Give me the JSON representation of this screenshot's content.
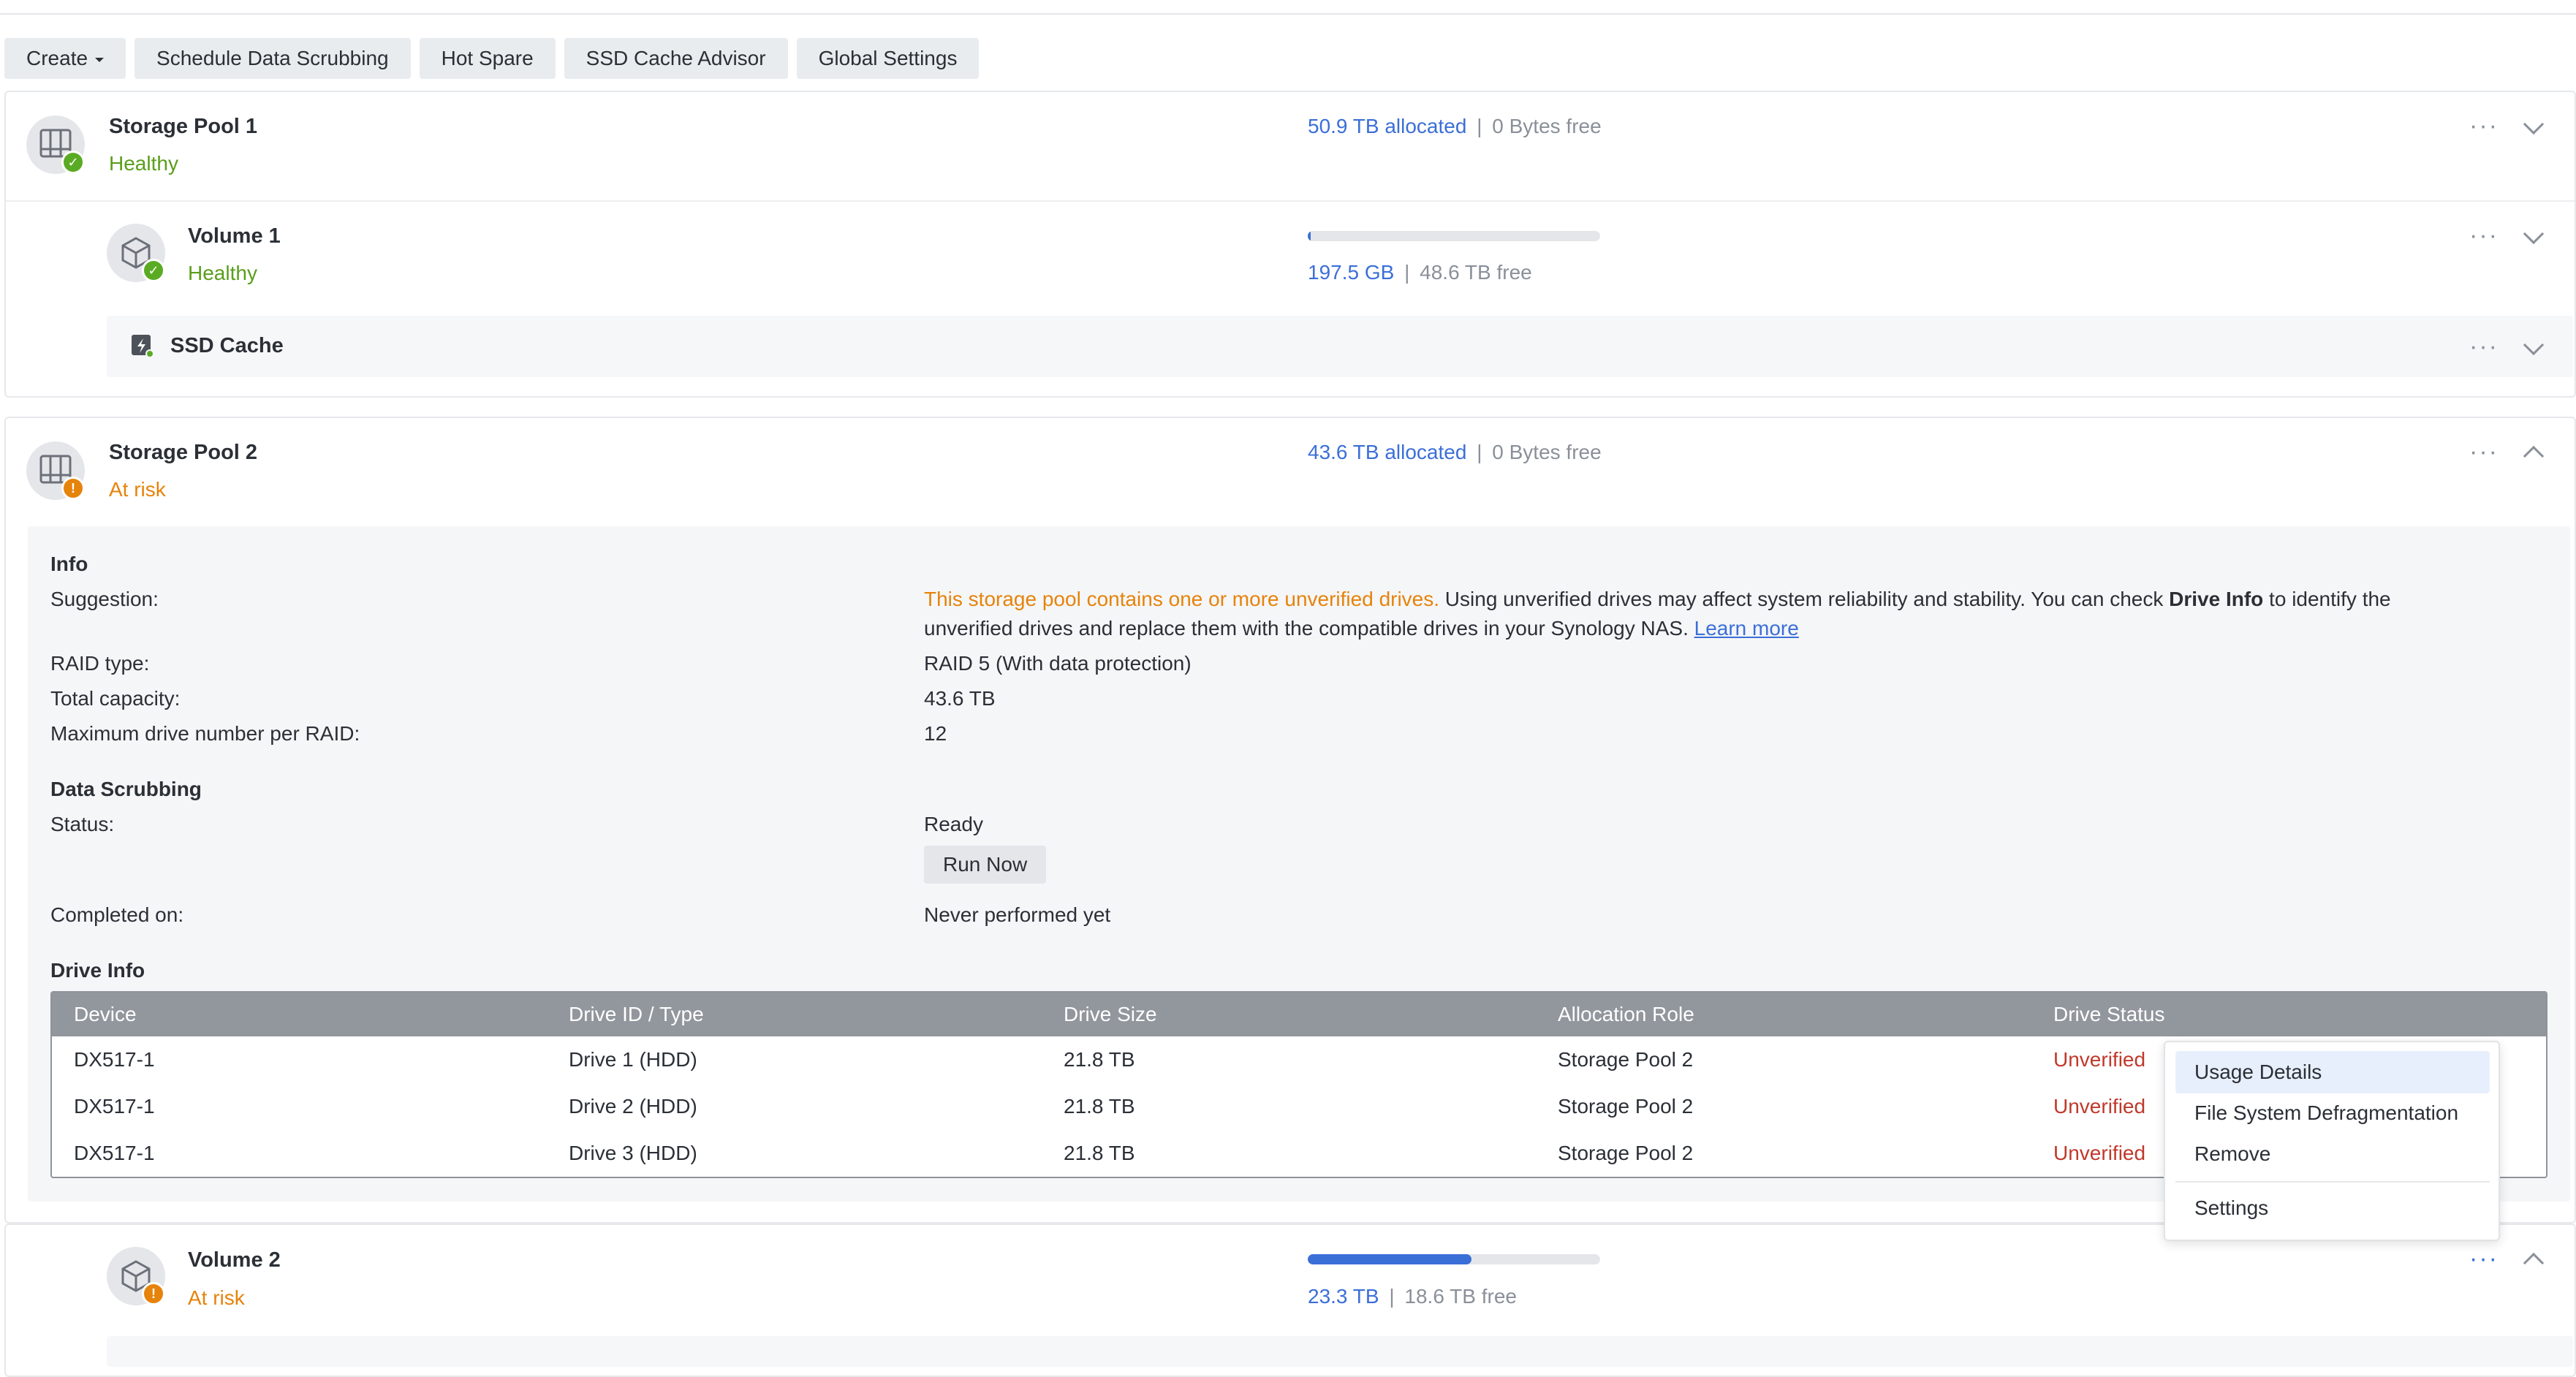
{
  "toolbar": {
    "create": "Create",
    "schedule": "Schedule Data Scrubbing",
    "hot_spare": "Hot Spare",
    "ssd_advisor": "SSD Cache Advisor",
    "global_settings": "Global Settings"
  },
  "pool1": {
    "title": "Storage Pool 1",
    "status": "Healthy",
    "allocated": "50.9 TB allocated",
    "separator": "|",
    "free": "0 Bytes free",
    "volume": {
      "title": "Volume 1",
      "status": "Healthy",
      "used": "197.5 GB",
      "separator": "|",
      "free": "48.6 TB free",
      "usage_fraction": 0.004
    },
    "ssd_cache": {
      "title": "SSD Cache"
    }
  },
  "pool2": {
    "title": "Storage Pool 2",
    "status": "At risk",
    "allocated": "43.6 TB allocated",
    "separator": "|",
    "free": "0 Bytes free",
    "info": {
      "heading": "Info",
      "suggestion_label": "Suggestion:",
      "suggestion_warn": "This storage pool contains one or more unverified drives.",
      "suggestion_text_a": " Using unverified drives may affect system reliability and stability. You can check ",
      "suggestion_bold": "Drive Info",
      "suggestion_text_b": " to identify the",
      "suggestion_line2": "unverified drives and replace them with the compatible drives in your Synology NAS. ",
      "learn_more": "Learn more",
      "raid_label": "RAID type:",
      "raid_value": "RAID 5 (With data protection)",
      "capacity_label": "Total capacity:",
      "capacity_value": "43.6 TB",
      "max_label": "Maximum drive number per RAID:",
      "max_value": "12"
    },
    "scrubbing": {
      "heading": "Data Scrubbing",
      "status_label": "Status:",
      "status_value": "Ready",
      "run_now": "Run Now",
      "completed_label": "Completed on:",
      "completed_value": "Never performed yet"
    },
    "drive_info": {
      "heading": "Drive Info",
      "columns": [
        "Device",
        "Drive ID / Type",
        "Drive Size",
        "Allocation Role",
        "Drive Status"
      ],
      "rows": [
        [
          "DX517-1",
          "Drive 1 (HDD)",
          "21.8 TB",
          "Storage Pool 2",
          "Unverified"
        ],
        [
          "DX517-1",
          "Drive 2 (HDD)",
          "21.8 TB",
          "Storage Pool 2",
          "Unverified"
        ],
        [
          "DX517-1",
          "Drive 3 (HDD)",
          "21.8 TB",
          "Storage Pool 2",
          "Unverified"
        ]
      ]
    },
    "volume": {
      "title": "Volume 2",
      "status": "At risk",
      "used": "23.3 TB",
      "separator": "|",
      "free": "18.6 TB free",
      "usage_fraction": 0.56
    }
  },
  "context_menu": {
    "items": [
      "Usage Details",
      "File System Defragmentation",
      "Remove",
      "Settings"
    ],
    "highlighted": "Usage Details"
  },
  "colors": {
    "accent": "#3b6fd8",
    "healthy": "#5a9e1b",
    "warning": "#e6830b",
    "unverified": "#c0392b"
  }
}
